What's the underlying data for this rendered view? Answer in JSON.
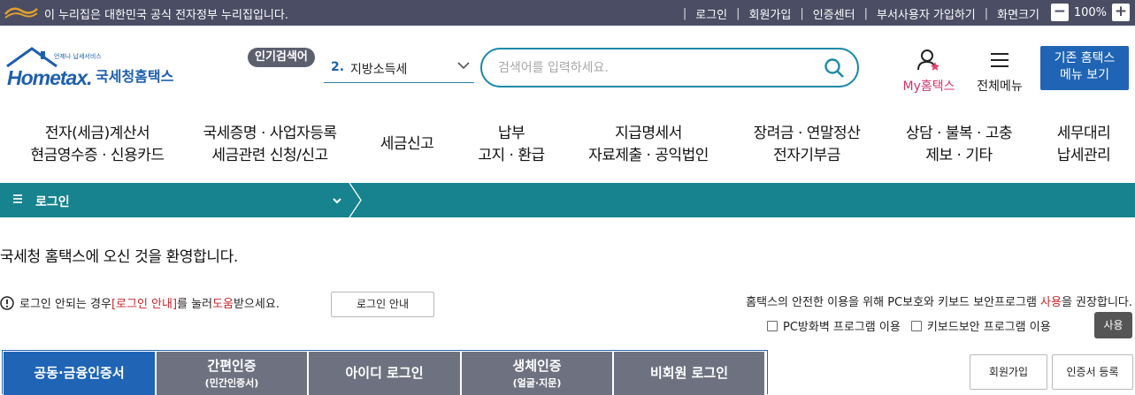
{
  "gov_bar": {
    "notice": "이 누리집은 대한민국 공식 전자정부 누리집입니다.",
    "links": [
      "로그인",
      "회원가입",
      "인증센터",
      "부서사용자 가입하기",
      "화면크기"
    ],
    "zoom_minus": "−",
    "zoom_value": "100%",
    "zoom_plus": "+"
  },
  "header": {
    "logo_sub": "언제나 납세서비스",
    "logo_word": "Hometax.",
    "logo_ko": "국세청홈택스",
    "popular_badge": "인기검색어",
    "popular_num": "2.",
    "popular_term": "지방소득세",
    "search_placeholder": "검색어를 입력하세요.",
    "my_hometax": "My홈택스",
    "all_menu": "전체메뉴",
    "old_home_line1": "기존 홈택스",
    "old_home_line2": "메뉴 보기"
  },
  "gnb": [
    {
      "line1": "전자(세금)계산서",
      "line2": "현금영수증 · 신용카드"
    },
    {
      "line1": "국세증명 · 사업자등록",
      "line2": "세금관련 신청/신고"
    },
    {
      "line1": "세금신고",
      "line2": ""
    },
    {
      "line1": "납부",
      "line2": "고지 · 환급"
    },
    {
      "line1": "지급명세서",
      "line2": "자료제출 · 공익법인"
    },
    {
      "line1": "장려금 · 연말정산",
      "line2": "전자기부금"
    },
    {
      "line1": "상담 · 불복 · 고충",
      "line2": "제보 · 기타"
    },
    {
      "line1": "세무대리",
      "line2": "납세관리"
    }
  ],
  "location": {
    "current": "로그인"
  },
  "content": {
    "welcome": "국세청 홈택스에 오신 것을 환영합니다.",
    "notice_pre": "로그인 안되는 경우 ",
    "notice_link": "[로그인 안내]",
    "notice_mid": "를 눌러 ",
    "notice_help": "도움",
    "notice_post": "받으세요.",
    "guide_button": "로그인 안내",
    "security_pre": "홈택스의 안전한 이용을 위해 PC보호와 키보드 보안프로그램 ",
    "security_use": "사용",
    "security_post": "을 권장합니다.",
    "check_pc_firewall": "PC방화벽 프로그램 이용",
    "check_keyboard": "키보드보안 프로그램 이용",
    "use_button": "사용"
  },
  "login_tabs": [
    {
      "label": "공동·금융인증서",
      "sub": ""
    },
    {
      "label": "간편인증",
      "sub": "(민간인증서)"
    },
    {
      "label": "아이디 로그인",
      "sub": ""
    },
    {
      "label": "생체인증",
      "sub": "(얼굴·지문)"
    },
    {
      "label": "비회원 로그인",
      "sub": ""
    }
  ],
  "side_buttons": {
    "join": "회원가입",
    "cert_register": "인증서 등록"
  },
  "colors": {
    "gov_bar": "#4a4d63",
    "brand_blue": "#1f64b5",
    "teal_bar": "#16838f",
    "search_border": "#1d8aa8",
    "tab_inactive": "#6e7280",
    "accent_red": "#c9252c"
  }
}
